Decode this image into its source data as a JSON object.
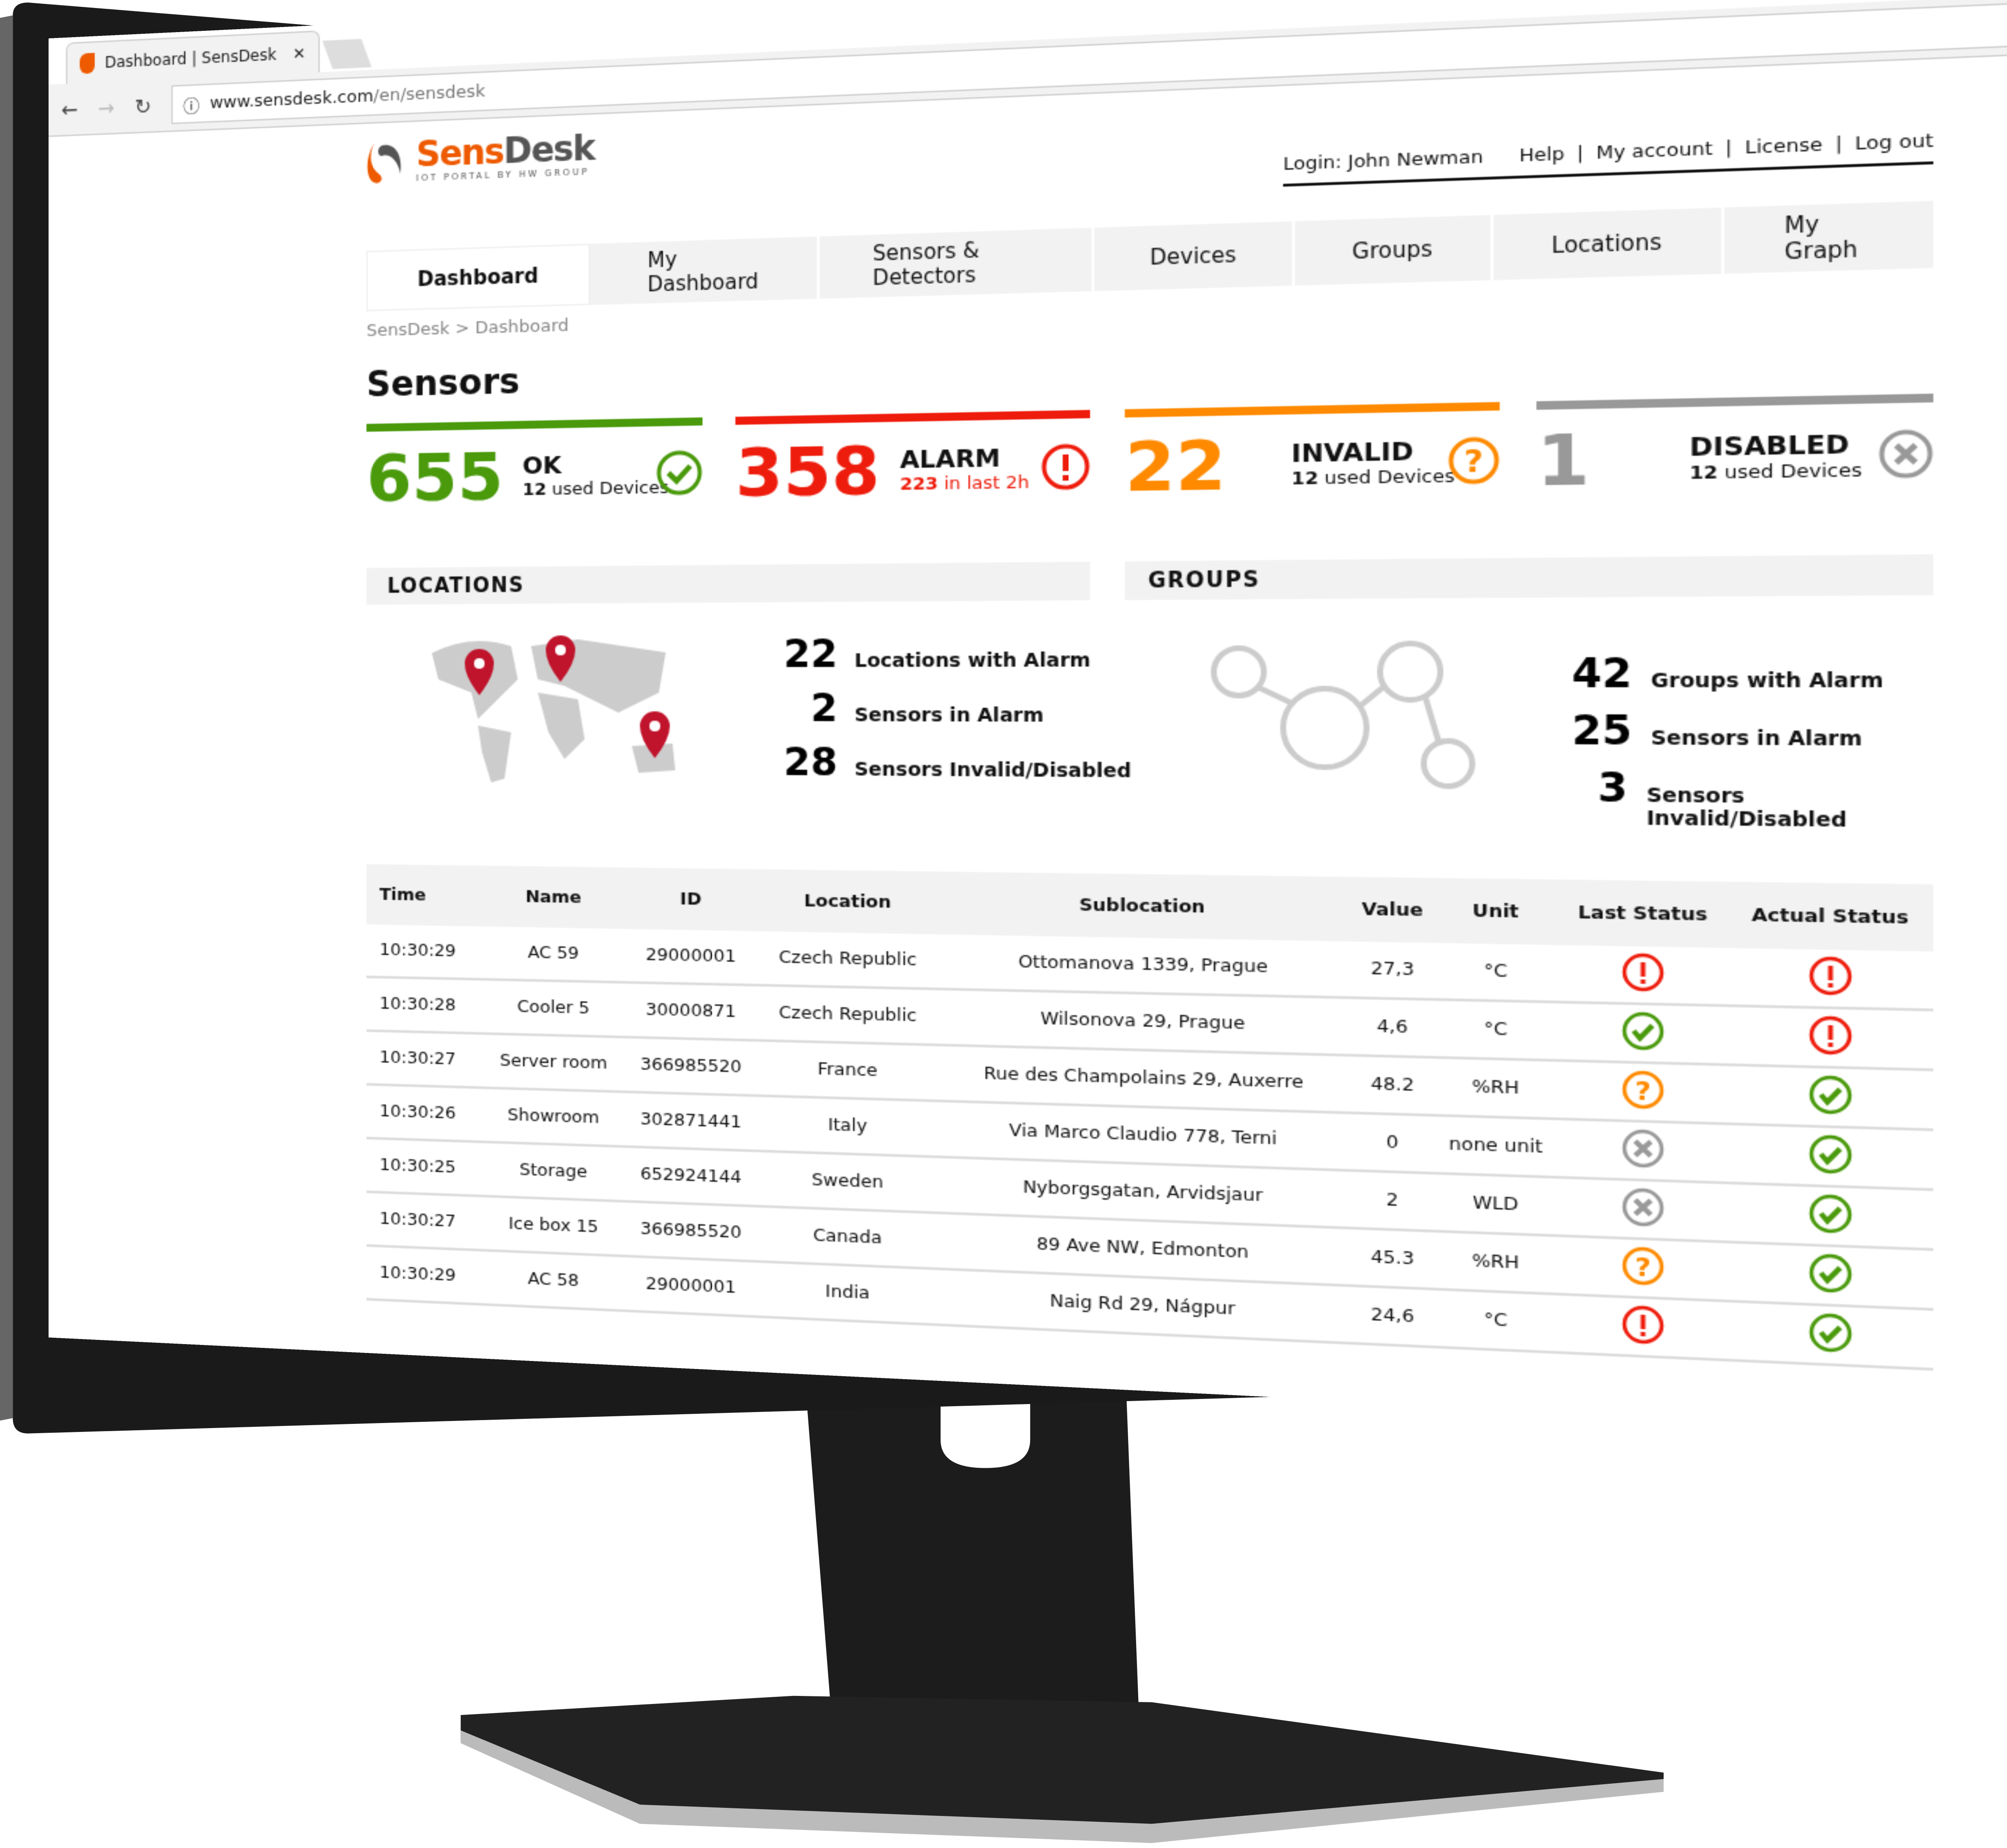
{
  "browser": {
    "tab_title": "Dashboard | SensDesk",
    "url_host": "www.sensdesk.com",
    "url_path": "/en/sensdesk"
  },
  "logo": {
    "part1": "Sens",
    "part2": "Desk",
    "tagline": "IOT PORTAL BY HW GROUP"
  },
  "userbar": {
    "login": "Login: John Newman",
    "links": [
      "Help",
      "My account",
      "License",
      "Log out"
    ]
  },
  "nav": {
    "tabs": [
      "Dashboard",
      "My Dashboard",
      "Sensors & Detectors",
      "Devices",
      "Groups",
      "Locations",
      "My Graph"
    ],
    "active": "Dashboard"
  },
  "breadcrumb": {
    "root": "SensDesk",
    "sep": ">",
    "current": "Dashboard"
  },
  "sensors": {
    "title": "Sensors",
    "ok": {
      "count": "655",
      "label": "OK",
      "sub_num": "12",
      "sub_text": "used Devices",
      "color": "#4a9a0c"
    },
    "alarm": {
      "count": "358",
      "label": "ALARM",
      "sub_num": "223",
      "sub_text": "in last 2h",
      "color": "#ee1c0c"
    },
    "invalid": {
      "count": "22",
      "label": "INVALID",
      "sub_num": "12",
      "sub_text": "used Devices",
      "color": "#ff8a00"
    },
    "disabled": {
      "count": "1",
      "label": "DISABLED",
      "sub_num": "12",
      "sub_text": "used Devices",
      "color": "#999999"
    }
  },
  "locations": {
    "title": "LOCATIONS",
    "figures": [
      {
        "n": "22",
        "t": "Locations with Alarm"
      },
      {
        "n": "2",
        "t": "Sensors in Alarm"
      },
      {
        "n": "28",
        "t": "Sensors Invalid/Disabled"
      }
    ]
  },
  "groups": {
    "title": "GROUPS",
    "figures": [
      {
        "n": "42",
        "t": "Groups with Alarm"
      },
      {
        "n": "25",
        "t": "Sensors in Alarm"
      },
      {
        "n": "3",
        "t": "Sensors Invalid/Disabled"
      }
    ]
  },
  "table": {
    "headers": [
      "Time",
      "Name",
      "ID",
      "Location",
      "Sublocation",
      "Value",
      "Unit",
      "Last Status",
      "Actual Status"
    ],
    "rows": [
      [
        "10:30:29",
        "AC 59",
        "29000001",
        "Czech Republic",
        "Ottomanova 1339, Prague",
        "27,3",
        "°C",
        "alarm",
        "alarm"
      ],
      [
        "10:30:28",
        "Cooler 5",
        "30000871",
        "Czech Republic",
        "Wilsonova 29, Prague",
        "4,6",
        "°C",
        "ok",
        "alarm"
      ],
      [
        "10:30:27",
        "Server room",
        "366985520",
        "France",
        "Rue des Champolains 29, Auxerre",
        "48.2",
        "%RH",
        "invalid",
        "ok"
      ],
      [
        "10:30:26",
        "Showroom",
        "302871441",
        "Italy",
        "Via Marco Claudio 778, Terni",
        "0",
        "none unit",
        "disabled",
        "ok"
      ],
      [
        "10:30:25",
        "Storage",
        "652924144",
        "Sweden",
        "Nyborgsgatan, Arvidsjaur",
        "2",
        "WLD",
        "disabled",
        "ok"
      ],
      [
        "10:30:27",
        "Ice box 15",
        "366985520",
        "Canada",
        "89 Ave NW, Edmonton",
        "45.3",
        "%RH",
        "invalid",
        "ok"
      ],
      [
        "10:30:29",
        "AC 58",
        "29000001",
        "India",
        "Naig Rd 29, Nágpur",
        "24,6",
        "°C",
        "alarm",
        "ok"
      ]
    ]
  },
  "status_colors": {
    "ok": "#4a9a0c",
    "alarm": "#ee1c0c",
    "invalid": "#ff8a00",
    "disabled": "#999999",
    "map_pin": "#c0142c"
  }
}
